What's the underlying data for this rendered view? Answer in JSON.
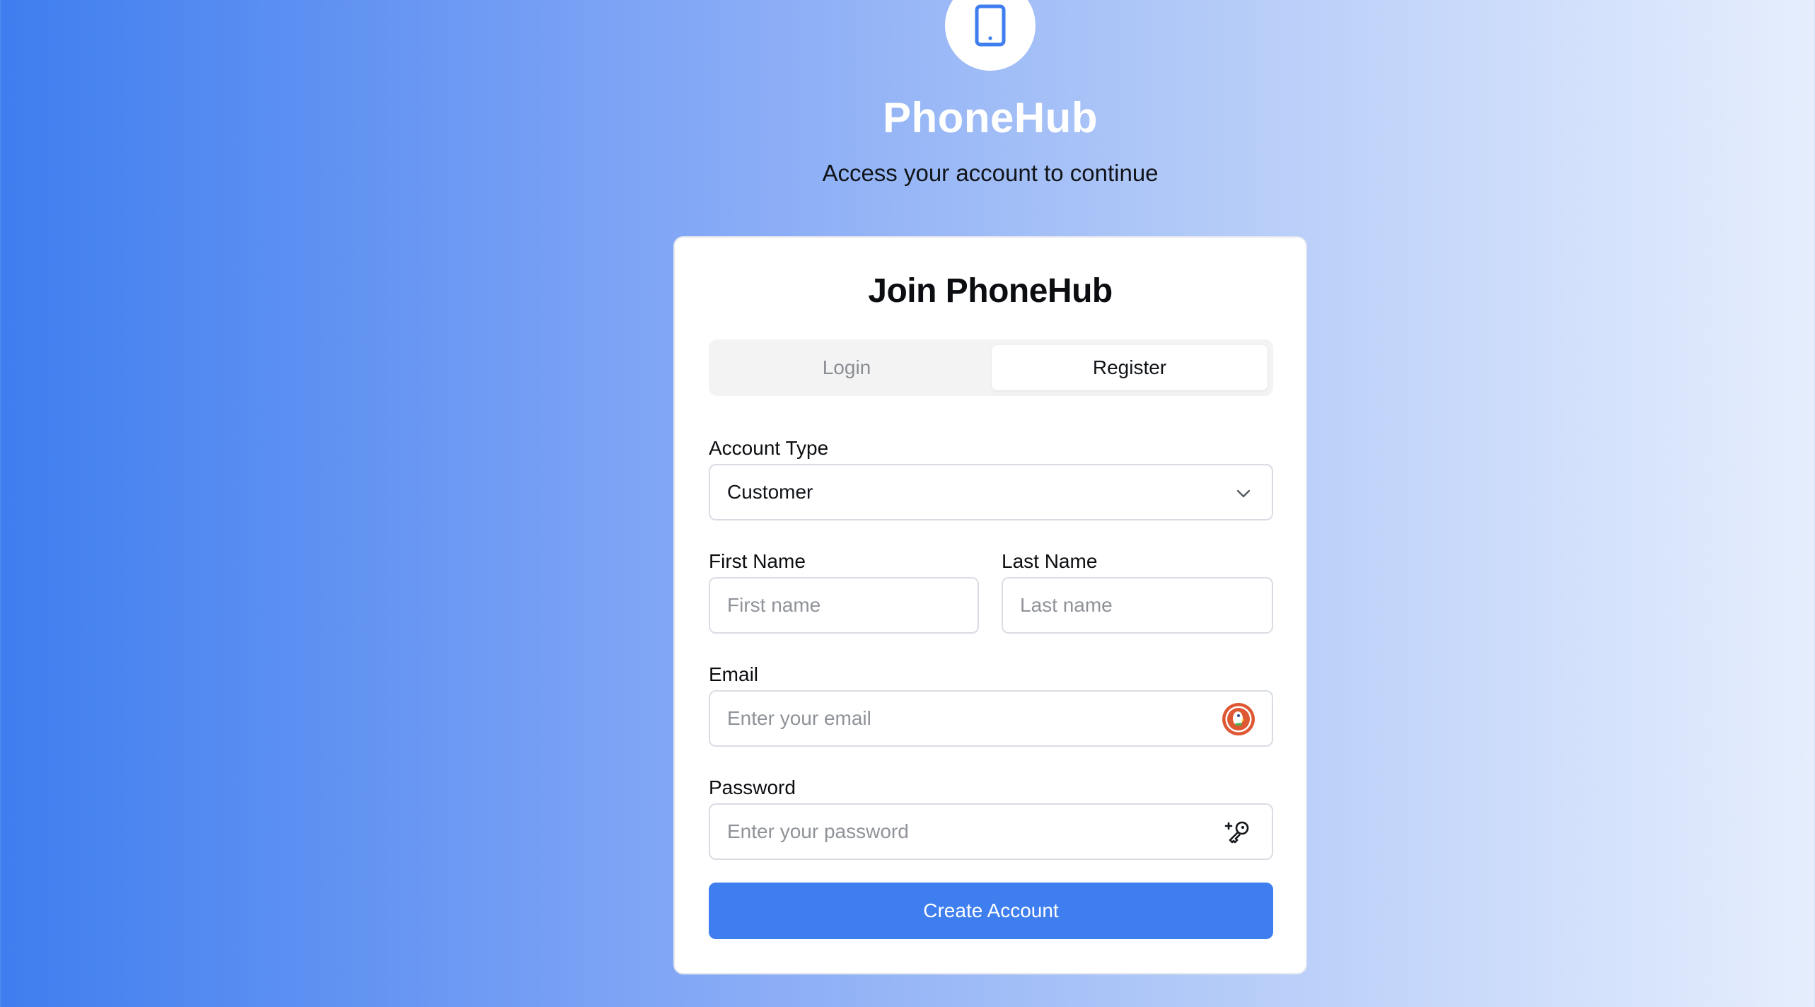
{
  "brand": {
    "name": "PhoneHub",
    "tagline": "Access your account to continue",
    "logo_icon": "smartphone-icon"
  },
  "card": {
    "title": "Join PhoneHub",
    "tabs": [
      {
        "label": "Login",
        "active": false
      },
      {
        "label": "Register",
        "active": true
      }
    ]
  },
  "form": {
    "account_type": {
      "label": "Account Type",
      "value": "Customer",
      "icon": "chevron-down-icon"
    },
    "first_name": {
      "label": "First Name",
      "placeholder": "First name",
      "value": ""
    },
    "last_name": {
      "label": "Last Name",
      "placeholder": "Last name",
      "value": ""
    },
    "email": {
      "label": "Email",
      "placeholder": "Enter your email",
      "value": "",
      "icon": "duckduckgo-icon"
    },
    "password": {
      "label": "Password",
      "placeholder": "Enter your password",
      "value": "",
      "icon": "key-plus-icon"
    },
    "submit_label": "Create Account"
  },
  "colors": {
    "accent": "#3f7eef",
    "background_start": "#3f7eef",
    "background_end": "#e6eefd"
  }
}
